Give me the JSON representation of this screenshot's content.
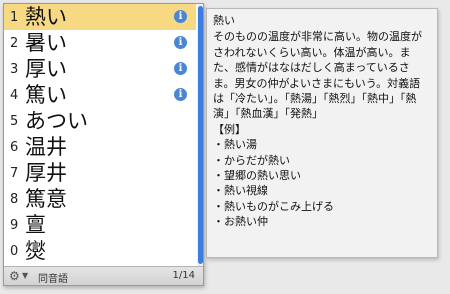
{
  "candidates": {
    "items": [
      {
        "num": "1",
        "word": "熱い",
        "info": true
      },
      {
        "num": "2",
        "word": "暑い",
        "info": true
      },
      {
        "num": "3",
        "word": "厚い",
        "info": true
      },
      {
        "num": "4",
        "word": "篤い",
        "info": true
      },
      {
        "num": "5",
        "word": "あつい",
        "info": false
      },
      {
        "num": "6",
        "word": "温井",
        "info": false
      },
      {
        "num": "7",
        "word": "厚井",
        "info": false
      },
      {
        "num": "8",
        "word": "篤意",
        "info": false
      },
      {
        "num": "9",
        "word": "亶",
        "info": false
      },
      {
        "num": "0",
        "word": "爕",
        "info": false
      }
    ],
    "info_glyph": "i",
    "selected_index": 0
  },
  "status_bar": {
    "gear_icon": "⚙",
    "dropdown_icon": "▼",
    "homonym_label": "同音語",
    "page": "1/14"
  },
  "annotation": {
    "title": "熱い",
    "body": "そのものの温度が非常に高い。物の温度がさわれないくらい高い。体温が高い。また、感情がはなはだしく高まっているさま。男女の仲がよいさまにもいう。対義語は「冷たい」。「熱湯」「熱烈」「熱中」「熱演」「熱血漢」「発熱」",
    "example_heading": "【例】",
    "examples": [
      "・熱い湯",
      "・からだが熱い",
      "・望郷の熱い思い",
      "・熱い視線",
      "・熱いものがこみ上げる",
      "・お熱い仲"
    ]
  },
  "colors": {
    "selected_row": "#f7d983",
    "info_icon": "#4a86d3",
    "scroll_thumb": "#3b7ee0"
  }
}
